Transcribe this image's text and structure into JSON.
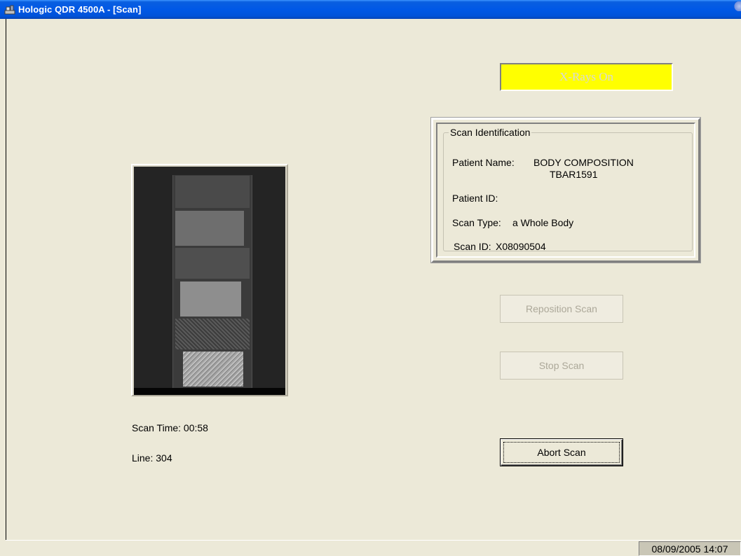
{
  "window": {
    "title": "Hologic QDR 4500A - [Scan]",
    "icon": "app-icon"
  },
  "xray_indicator": {
    "label": "X-Rays On",
    "color": "#ffff00"
  },
  "scan_identification": {
    "legend": "Scan Identification",
    "patient_name_label": "Patient Name:",
    "patient_name_line1": "BODY COMPOSITION",
    "patient_name_line2": "TBAR1591",
    "patient_id_label": "Patient ID:",
    "patient_id_value": "",
    "scan_type_label": "Scan Type:",
    "scan_type_value": "a Whole Body",
    "scan_id_label": "Scan ID:",
    "scan_id_value": "X08090504"
  },
  "scan_status": {
    "scan_time": "Scan Time: 00:58",
    "line": "Line: 304"
  },
  "buttons": {
    "reposition": "Reposition Scan",
    "stop": "Stop Scan",
    "abort": "Abort Scan"
  },
  "statusbar": {
    "datetime": "08/09/2005 14:07"
  }
}
